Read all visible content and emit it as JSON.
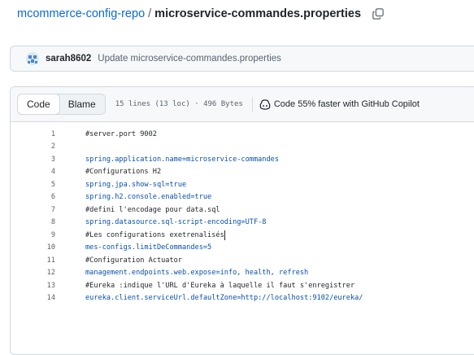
{
  "breadcrumb": {
    "repo": "mcommerce-config-repo",
    "separator": "/",
    "file": "microservice-commandes.properties"
  },
  "commit": {
    "author": "sarah8602",
    "message": "Update microservice-commandes.properties"
  },
  "file_header": {
    "tabs": [
      "Code",
      "Blame"
    ],
    "active_tab": "Code",
    "info": "15 lines (13 loc) · 496 Bytes",
    "copilot_text": "Code 55% faster with GitHub Copilot"
  },
  "code": {
    "lines": [
      {
        "n": "1",
        "text": "#server.port 9002"
      },
      {
        "n": "2",
        "text": ""
      },
      {
        "n": "3",
        "text": "spring.application.name=microservice-commandes"
      },
      {
        "n": "4",
        "text": "#Configurations H2"
      },
      {
        "n": "5",
        "text": "spring.jpa.show-sql=true"
      },
      {
        "n": "6",
        "text": "spring.h2.console.enabled=true"
      },
      {
        "n": "7",
        "text": "#defini l'encodage pour data.sql"
      },
      {
        "n": "8",
        "text": "spring.datasource.sql-script-encoding=UTF-8"
      },
      {
        "n": "9",
        "text": "#Les configurations exetrenalisés"
      },
      {
        "n": "10",
        "text": "mes-configs.limitDeCommandes=5"
      },
      {
        "n": "11",
        "text": "#Configuration Actuator"
      },
      {
        "n": "12",
        "text": "management.endpoints.web.expose=info, health, refresh"
      },
      {
        "n": "13",
        "text": "#Eureka :indique l'URL d'Eureka à laquelle il faut s'enregistrer"
      },
      {
        "n": "14",
        "text": "eureka.client.serviceUrl.defaultZone=http://localhost:9102/eureka/"
      }
    ]
  },
  "colors": {
    "link": "#0969da",
    "key_value": "#0550ae",
    "muted": "#59636e"
  }
}
